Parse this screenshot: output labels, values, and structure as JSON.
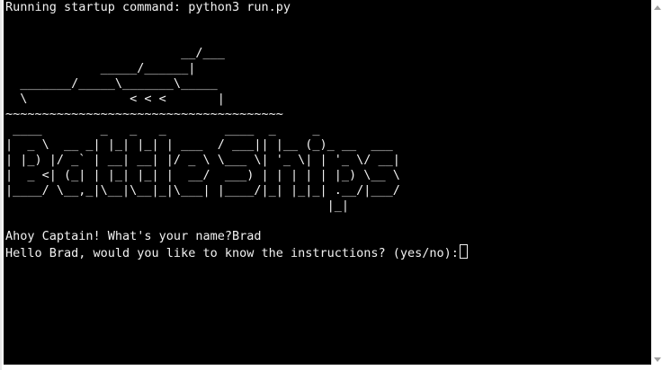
{
  "terminal": {
    "startup_line": "Running startup command: python3 run.py",
    "ship_art": "\n\n                        __/___\n             _____/______|\n  _______/_____\\_______\\_____\n  \\              < < <       |\n~~~~~~~~~~~~~~~~~~~~~~~~~~~~~~~~~~~~~~",
    "title_art": " ____        _   _   _        ____  _     _\n|  _ \\  __ _| |_| |_| | ___  / ___|| |__ (_)_ __  ___\n| |_) |/ _` | __| __| |/ _ \\ \\___ \\| '_ \\| | '_ \\/ __|\n|  _ <| (_| | |_| |_| |  __/  ___) | | | | | |_) \\__ \\\n|____/ \\__,_|\\__|\\__|_|\\___| |____/|_| |_|_| .__/|___/\n                                            |_|",
    "name_prompt": "Ahoy Captain! What's your name?",
    "name_value": "Brad",
    "instructions_prompt": "Hello Brad, would you like to know the instructions? (yes/no):"
  }
}
